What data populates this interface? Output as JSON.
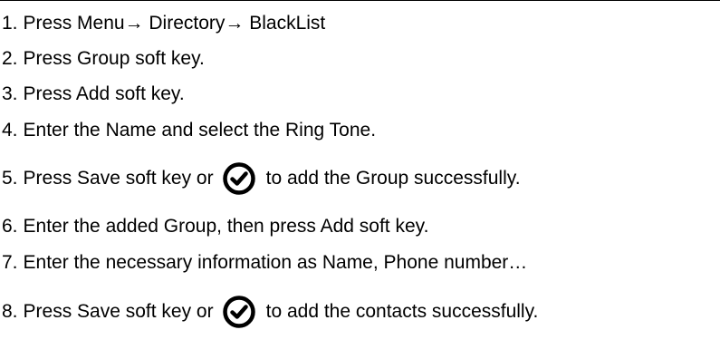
{
  "steps": [
    {
      "num": "1.",
      "text": "Press Menu→ Directory→ BlackList"
    },
    {
      "num": "2.",
      "text": "Press Group soft key."
    },
    {
      "num": "3.",
      "text": "Press Add soft key."
    },
    {
      "num": "4.",
      "text": "Enter the Name and select the Ring Tone."
    },
    {
      "num": "5.",
      "before": "Press Save soft key or",
      "after": "to add the Group successfully.",
      "icon": "ok-check-icon"
    },
    {
      "num": "6.",
      "text": "Enter the added Group, then press Add soft key."
    },
    {
      "num": "7.",
      "text": "Enter the necessary information as Name, Phone number…"
    },
    {
      "num": "8.",
      "before": "Press Save soft key or",
      "after": "to add the contacts successfully.",
      "icon": "ok-check-icon"
    }
  ],
  "colors": {
    "text": "#000000",
    "background": "#ffffff"
  }
}
